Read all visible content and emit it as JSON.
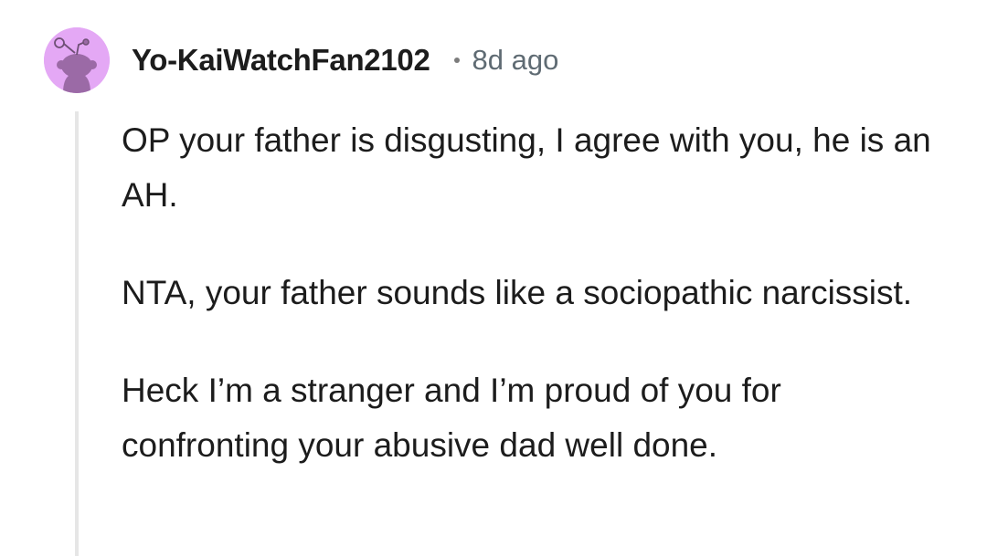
{
  "comment": {
    "author": "Yo-KaiWatchFan2102",
    "separator_icon": "dot-icon",
    "timestamp": "8d ago",
    "avatar_icon": "snoo-avatar-icon",
    "avatar_color": "#e4a8f5",
    "paragraphs": [
      "OP your father is disgusting, I agree with you, he is an AH.",
      "NTA, your father sounds like a sociopathic narcissist.",
      "Heck I’m a stranger and I’m proud of you for confronting your abusive dad well done."
    ]
  }
}
